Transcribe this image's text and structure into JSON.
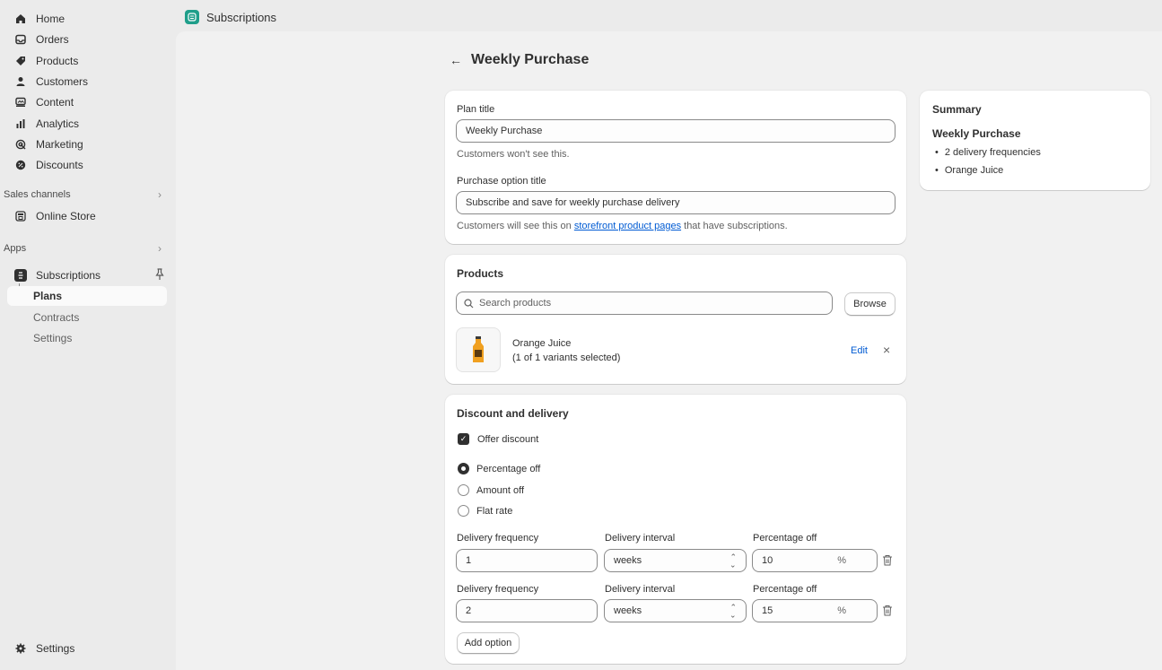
{
  "sidebar": {
    "items": [
      {
        "label": "Home",
        "icon": "home-icon"
      },
      {
        "label": "Orders",
        "icon": "inbox-icon"
      },
      {
        "label": "Products",
        "icon": "tag-icon"
      },
      {
        "label": "Customers",
        "icon": "person-icon"
      },
      {
        "label": "Content",
        "icon": "content-icon"
      },
      {
        "label": "Analytics",
        "icon": "bar-chart-icon"
      },
      {
        "label": "Marketing",
        "icon": "target-icon"
      },
      {
        "label": "Discounts",
        "icon": "discount-icon"
      }
    ],
    "sales_channels_label": "Sales channels",
    "online_store_label": "Online Store",
    "apps_label": "Apps",
    "subscriptions_label": "Subscriptions",
    "sub_items": [
      {
        "label": "Plans",
        "active": true
      },
      {
        "label": "Contracts",
        "active": false
      },
      {
        "label": "Settings",
        "active": false
      }
    ],
    "settings_label": "Settings"
  },
  "topbar": {
    "app_title": "Subscriptions"
  },
  "page": {
    "title": "Weekly Purchase"
  },
  "plan": {
    "plan_title_label": "Plan title",
    "plan_title_value": "Weekly Purchase",
    "plan_title_help": "Customers won't see this.",
    "purchase_option_label": "Purchase option title",
    "purchase_option_value": "Subscribe and save for weekly purchase delivery",
    "purchase_help_before": "Customers will see this on ",
    "purchase_help_link": "storefront product pages",
    "purchase_help_after": " that have subscriptions."
  },
  "products": {
    "heading": "Products",
    "search_placeholder": "Search products",
    "browse_label": "Browse",
    "item_name": "Orange Juice",
    "item_variants": "(1 of 1 variants selected)",
    "edit_label": "Edit",
    "remove_glyph": "×"
  },
  "discount": {
    "heading": "Discount and delivery",
    "offer_discount_label": "Offer discount",
    "offer_discount_checked": true,
    "options": [
      {
        "label": "Percentage off",
        "selected": true
      },
      {
        "label": "Amount off",
        "selected": false
      },
      {
        "label": "Flat rate",
        "selected": false
      }
    ],
    "frequency_label": "Delivery frequency",
    "interval_label": "Delivery interval",
    "percentage_label": "Percentage off",
    "rows": [
      {
        "frequency": "1",
        "interval": "weeks",
        "percentage": "10",
        "suffix": "%"
      },
      {
        "frequency": "2",
        "interval": "weeks",
        "percentage": "15",
        "suffix": "%"
      }
    ],
    "add_option_label": "Add option"
  },
  "summary": {
    "heading": "Summary",
    "plan_name": "Weekly Purchase",
    "items": [
      "2 delivery frequencies",
      "Orange Juice"
    ]
  },
  "colors": {
    "accent_link": "#005bd3",
    "app_icon": "#1f9e8a",
    "dark": "#303030"
  }
}
